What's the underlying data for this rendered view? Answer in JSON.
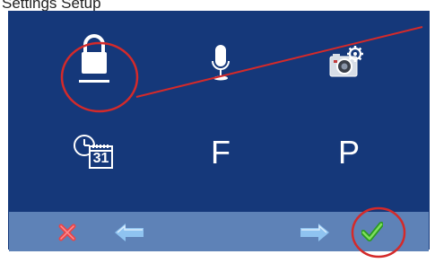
{
  "caption": {
    "text": "Settings Setup"
  },
  "grid": [
    {
      "name": "lock",
      "icon": "lock-icon"
    },
    {
      "name": "microphone",
      "icon": "microphone-icon"
    },
    {
      "name": "camera-settings",
      "icon": "camera-gear-icon"
    },
    {
      "name": "calendar-clock",
      "icon": "clock-calendar-icon",
      "calendar_day": "31"
    },
    {
      "name": "letter-f",
      "label": "F"
    },
    {
      "name": "letter-p",
      "label": "P"
    }
  ],
  "toolbar": {
    "cancel_icon": "close-icon",
    "back_icon": "arrow-left-icon",
    "next_icon": "arrow-right-icon",
    "confirm_icon": "checkmark-icon"
  },
  "colors": {
    "background": "#15387a",
    "toolbar": "#5e82b7",
    "highlight_circle": "#d42a2a",
    "confirm": "#3fbf2f",
    "cancel": "#e8464a",
    "arrow": "#8fc3f0"
  }
}
